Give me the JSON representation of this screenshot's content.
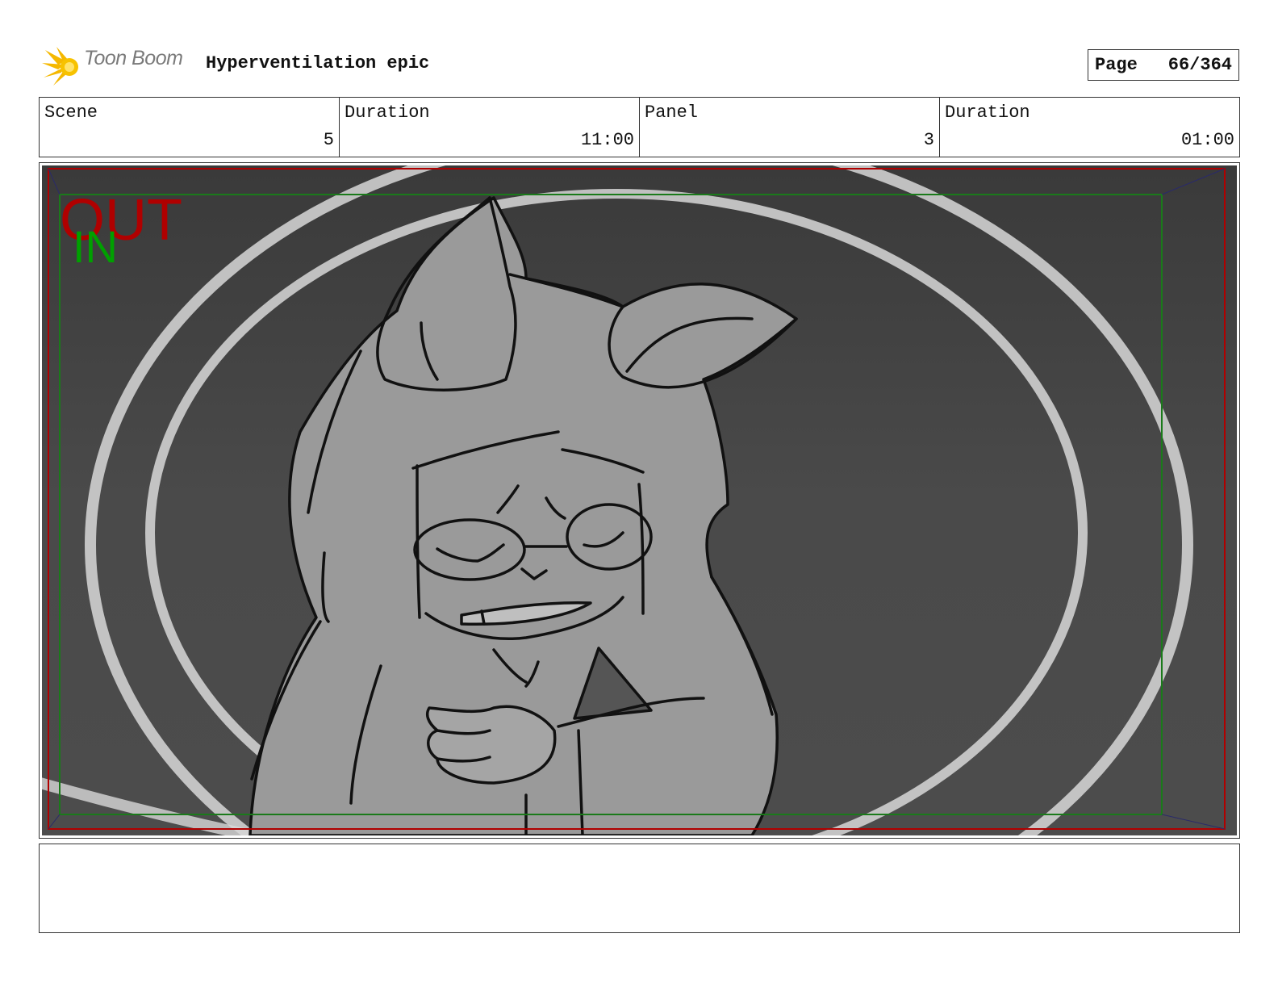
{
  "header": {
    "logo_text": "Toon Boom",
    "project_title": "Hyperventilation epic",
    "page_label": "Page",
    "page_value": "66/364"
  },
  "info": [
    {
      "label": "Scene",
      "value": "5"
    },
    {
      "label": "Duration",
      "value": "11:00"
    },
    {
      "label": "Panel",
      "value": "3"
    },
    {
      "label": "Duration",
      "value": "01:00"
    }
  ],
  "panel": {
    "out_label": "OUT",
    "in_label": "IN",
    "colors": {
      "out": "#b00000",
      "in": "#00a000",
      "background": "#4a4a4a"
    }
  },
  "notes": {
    "text": ""
  }
}
